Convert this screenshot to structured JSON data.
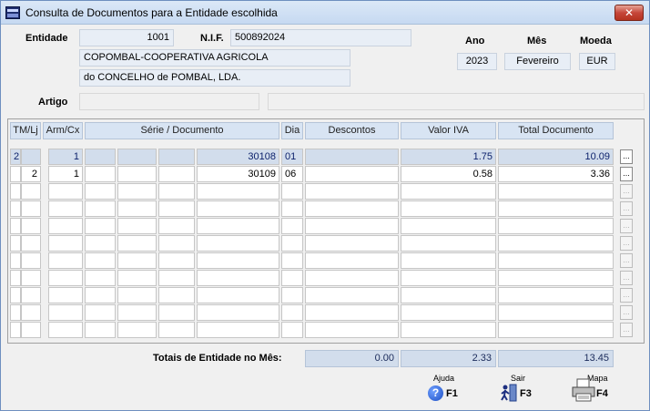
{
  "window": {
    "title": "Consulta de Documentos para a Entidade escolhida",
    "close_glyph": "✕"
  },
  "header": {
    "entidade_label": "Entidade",
    "entidade_value": "1001",
    "nif_label": "N.I.F.",
    "nif_value": "500892024",
    "name_line1": "COPOMBAL-COOPERATIVA AGRICOLA",
    "name_line2": "do CONCELHO de POMBAL, LDA.",
    "ano_label": "Ano",
    "ano_value": "2023",
    "mes_label": "Mês",
    "mes_value": "Fevereiro",
    "moeda_label": "Moeda",
    "moeda_value": "EUR",
    "artigo_label": "Artigo",
    "artigo_value": "",
    "artigo_desc": ""
  },
  "table": {
    "headers": [
      "TM/Lj",
      "Arm/Cx",
      "Série / Documento",
      "Dia",
      "Descontos",
      "Valor IVA",
      "Total Documento"
    ],
    "rows": [
      {
        "tm": "2",
        "lj": "",
        "arm": "1",
        "s1": "",
        "s2": "",
        "s3": "",
        "doc": "30108",
        "dia": "01",
        "desc": "",
        "iva": "1.75",
        "total": "10.09",
        "selected": true
      },
      {
        "tm": "",
        "lj": "2",
        "arm": "1",
        "s1": "",
        "s2": "",
        "s3": "",
        "doc": "30109",
        "dia": "06",
        "desc": "",
        "iva": "0.58",
        "total": "3.36",
        "selected": false
      }
    ],
    "empty_rows": 9,
    "row_button_label": "..."
  },
  "totals": {
    "label": "Totais de Entidade no Mês:",
    "descontos": "0.00",
    "iva": "2.33",
    "total": "13.45"
  },
  "fkeys": {
    "help": {
      "caption": "Ajuda",
      "key": "F1"
    },
    "exit": {
      "caption": "Sair",
      "key": "F3"
    },
    "map": {
      "caption": "Mapa",
      "key": "F4"
    }
  },
  "colors": {
    "title_bg": "#c6d9f1",
    "close_red": "#c6463a",
    "selected_row": "#d2ddec",
    "header_cell": "#d8e4f3"
  }
}
